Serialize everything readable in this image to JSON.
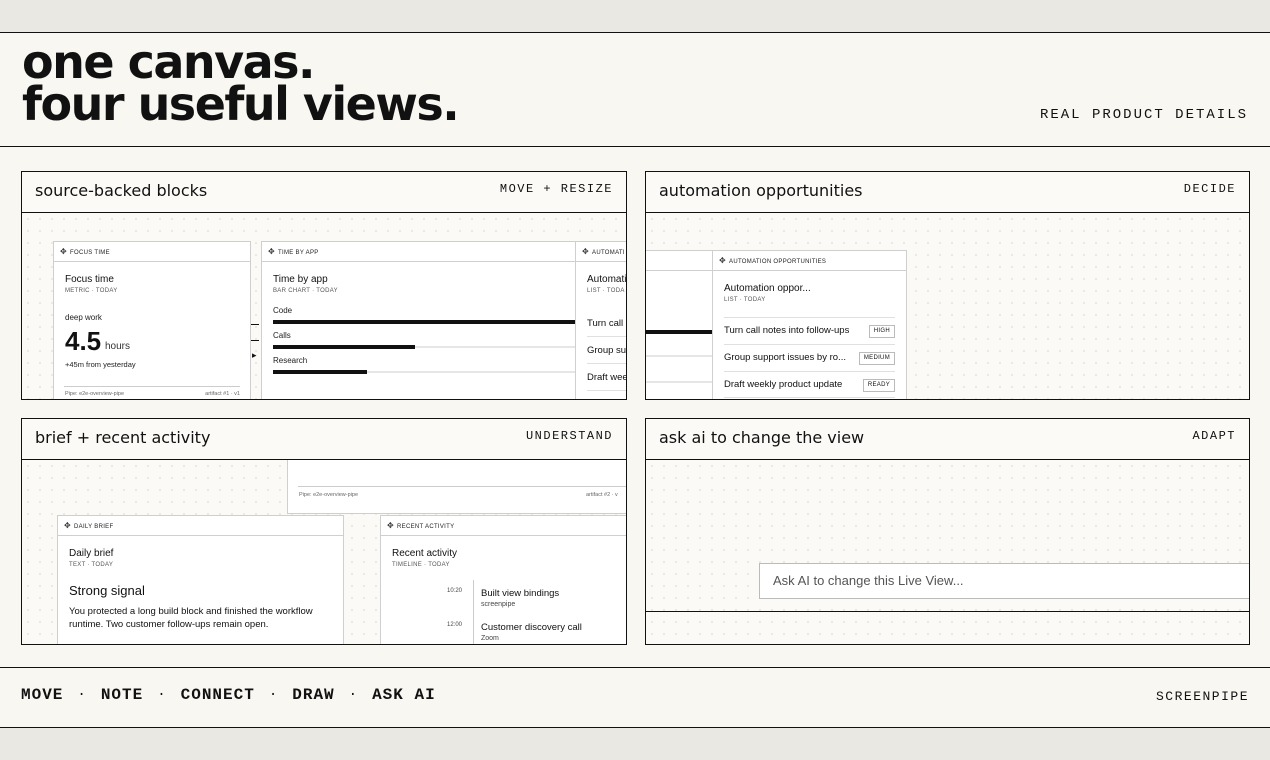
{
  "hero": {
    "line1": "one canvas.",
    "line2": "four useful views.",
    "tag": "REAL PRODUCT DETAILS"
  },
  "cards": [
    {
      "title": "source-backed blocks",
      "tag": "MOVE + RESIZE"
    },
    {
      "title": "automation opportunities",
      "tag": "DECIDE"
    },
    {
      "title": "brief + recent activity",
      "tag": "UNDERSTAND"
    },
    {
      "title": "ask ai to change the view",
      "tag": "ADAPT"
    }
  ],
  "focus_time": {
    "header": "FOCUS TIME",
    "title": "Focus time",
    "sub": "METRIC · TODAY",
    "label": "deep work",
    "value": "4.5",
    "unit": "hours",
    "delta": "+45m from yesterday",
    "pipe": "Pipe: e2e-overview-pipe",
    "artifact": "artifact #1 · v1"
  },
  "time_by_app": {
    "header": "TIME BY APP",
    "title": "Time by app",
    "sub": "BAR CHART · TODAY",
    "bars": [
      {
        "label": "Code",
        "value": 1.0
      },
      {
        "label": "Calls",
        "value": 0.47
      },
      {
        "label": "Research",
        "value": 0.31
      }
    ]
  },
  "automation_clip": {
    "header": "AUTOMATI",
    "title": "Automati",
    "sub": "LIST · TODA",
    "rows": [
      "Turn call",
      "Group su",
      "Draft wee"
    ]
  },
  "automation": {
    "header": "AUTOMATION OPPORTUNITIES",
    "title": "Automation oppor...",
    "sub": "LIST · TODAY",
    "items": [
      {
        "text": "Turn call notes into follow-ups",
        "badge": "HIGH"
      },
      {
        "text": "Group support issues by ro...",
        "badge": "MEDIUM"
      },
      {
        "text": "Draft weekly product update",
        "badge": "READY"
      }
    ]
  },
  "pipe_strip": {
    "pipe": "Pipe: e2e-overview-pipe",
    "artifact": "artifact #2 · v"
  },
  "daily_brief": {
    "header": "DAILY BRIEF",
    "title": "Daily brief",
    "sub": "TEXT · TODAY",
    "headline": "Strong signal",
    "body": "You protected a long build block and finished the workflow runtime. Two customer follow-ups remain open."
  },
  "recent_activity": {
    "header": "RECENT ACTIVITY",
    "title": "Recent activity",
    "sub": "TIMELINE · TODAY",
    "events": [
      {
        "time": "10:20",
        "title": "Built view bindings",
        "app": "screenpipe"
      },
      {
        "time": "12:00",
        "title": "Customer discovery call",
        "app": "Zoom"
      }
    ]
  },
  "ask": {
    "placeholder": "Ask AI to change this Live View..."
  },
  "footer": {
    "nav": [
      "MOVE",
      "NOTE",
      "CONNECT",
      "DRAW",
      "ASK AI"
    ],
    "brand": "SCREENPIPE"
  }
}
